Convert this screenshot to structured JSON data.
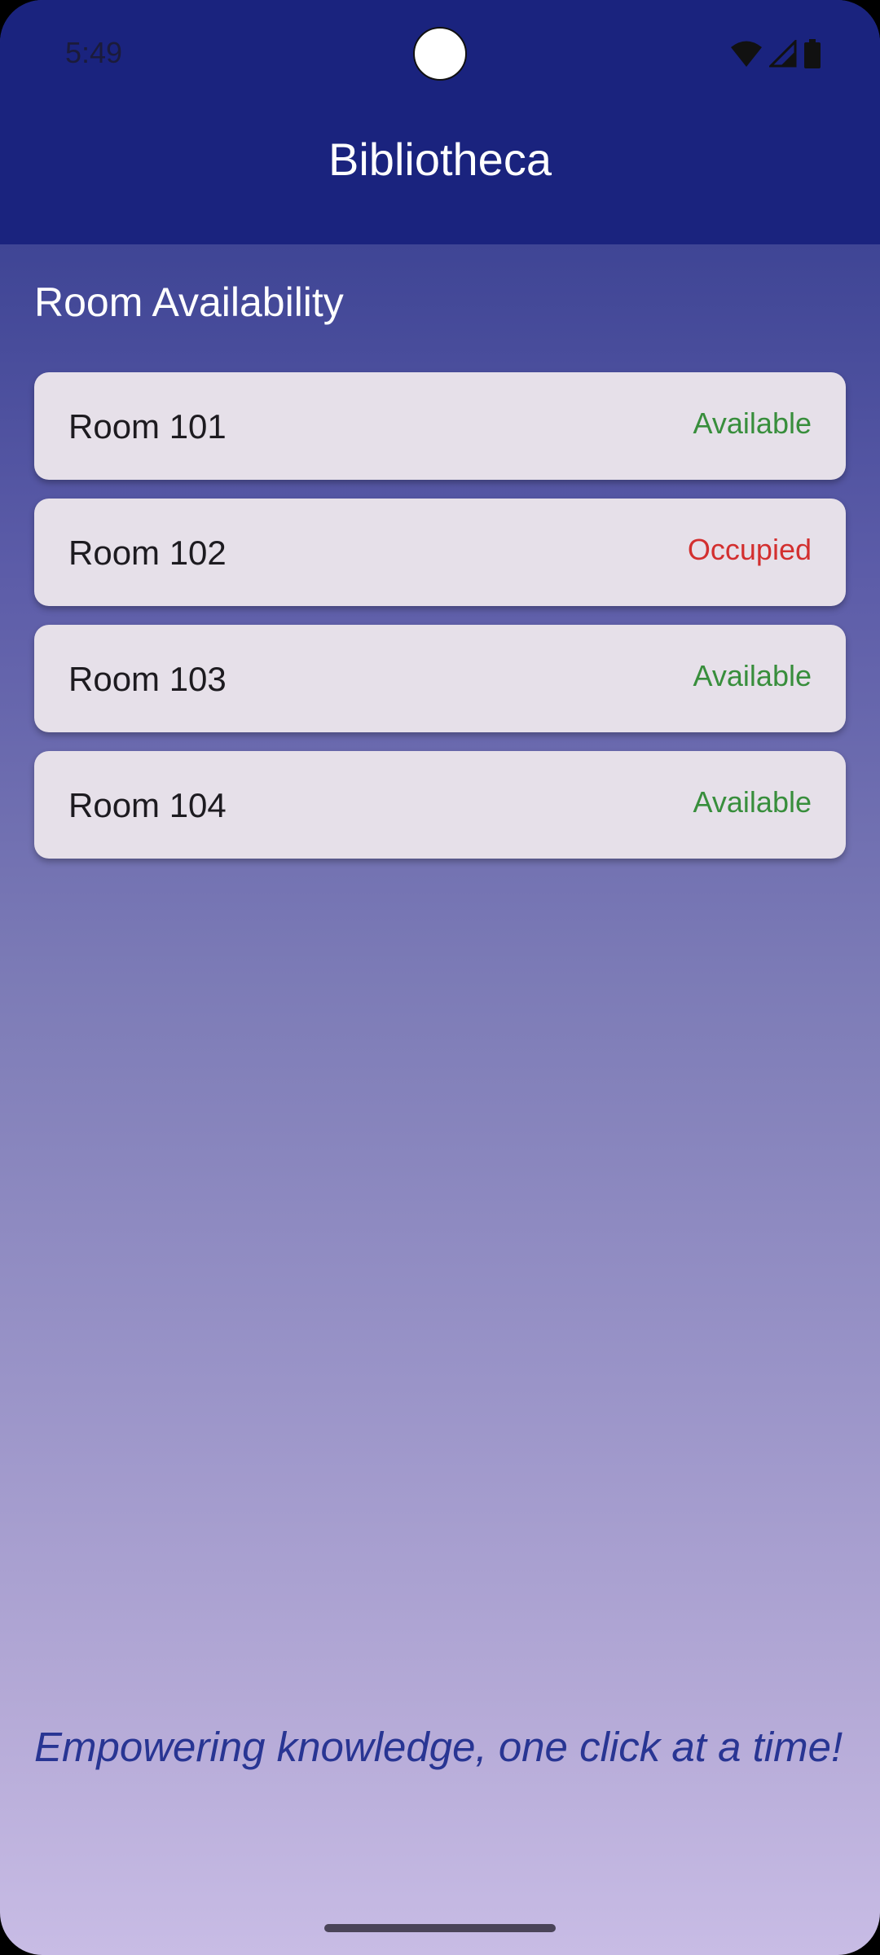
{
  "status_bar": {
    "time": "5:49",
    "icons": [
      "wifi-icon",
      "cell-signal-icon",
      "battery-icon"
    ]
  },
  "app_bar": {
    "title": "Bibliotheca"
  },
  "section": {
    "title": "Room Availability"
  },
  "rooms": [
    {
      "name": "Room 101",
      "status": "Available"
    },
    {
      "name": "Room 102",
      "status": "Occupied"
    },
    {
      "name": "Room 103",
      "status": "Available"
    },
    {
      "name": "Room 104",
      "status": "Available"
    }
  ],
  "tagline": "Empowering knowledge, one click at a time!",
  "colors": {
    "primary": "#1a237e",
    "available": "#388e3c",
    "occupied": "#d32f2f",
    "card": "#e6e0e9",
    "tagline": "#283593"
  }
}
